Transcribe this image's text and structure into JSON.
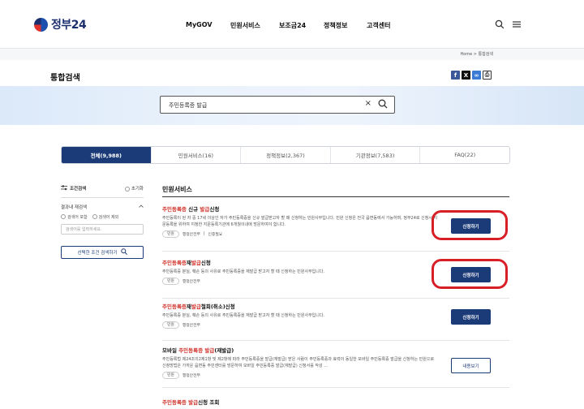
{
  "header": {
    "logo_text": "정부24",
    "nav": [
      "MyGOV",
      "민원서비스",
      "보조금24",
      "정책정보",
      "고객센터"
    ],
    "icons": [
      "search-icon",
      "menu-icon"
    ]
  },
  "breadcrumb": {
    "home": "Home",
    "sep": ">",
    "current": "통합검색"
  },
  "page_title": "통합검색",
  "share_icons": [
    "facebook-icon",
    "x-icon",
    "link-icon",
    "print-icon"
  ],
  "search": {
    "value": "주민등록증 발급",
    "clear_glyph": "×",
    "search_glyph": "⌕"
  },
  "tabs": [
    {
      "label": "전체(9,988)",
      "active": true
    },
    {
      "label": "민원서비스(16)",
      "active": false
    },
    {
      "label": "정책정보(2,367)",
      "active": false
    },
    {
      "label": "기관정보(7,583)",
      "active": false
    },
    {
      "label": "FAQ(22)",
      "active": false
    }
  ],
  "filter": {
    "title": "조건검색",
    "reset": "초기화",
    "sub_title": "결과내 재검색",
    "radio_include": "검색어 포함",
    "radio_exclude": "검색어 제외",
    "keyword_placeholder": "검색어를 입력하세요.",
    "apply_button": "선택한 조건 검색하기"
  },
  "results": {
    "section_title": "민원서비스",
    "items": [
      {
        "title_plain_pre": "",
        "title_hl": "주민등록증",
        "title_mid": " 신규 ",
        "title_hl2": "발급",
        "title_post": "신청",
        "desc": "주민등록이 된 자 중 17세 이상인 자가 주민등록증을 신규 발급받고자 할 때 신청하는 민원사무입니다. 민원 신청은 전국 읍면동에서 가능하며, 정부24로 신청시 지문등록을 위하여 지정한 지문등록기관에 6개월이내에 방문하여야 합니다.",
        "tags": [
          "민원",
          "행정안전부",
          "인증필요"
        ],
        "button": "신청하기"
      },
      {
        "title_plain_pre": "",
        "title_hl": "주민등록증",
        "title_mid": "재",
        "title_hl2": "발급",
        "title_post": "신청",
        "desc": "주민등록증 분실, 훼손 등의 사유로 주민등록증을 재발급 받고자 할 때 신청하는 민원사무입니다.",
        "tags": [
          "민원",
          "행정안전부"
        ],
        "button": "신청하기"
      },
      {
        "title_plain_pre": "",
        "title_hl": "주민등록증",
        "title_mid": "재",
        "title_hl2": "발급",
        "title_post": "철회(취소)신청",
        "desc": "주민등록증 분실, 훼손 등의 사유로 주민등록증을 재발급 받고자 할 때 신청하는 민원사무입니다.",
        "tags": [
          "민원",
          "행정안전부"
        ],
        "button": "신청하기"
      },
      {
        "title_plain_pre": "모바일 ",
        "title_hl": "주민등록증",
        "title_mid": " ",
        "title_hl2": "발급",
        "title_post": "(재발급)",
        "desc": "주민등록법 제24조의2제1항 및 제2항에 따라 주민등록증을 발급(재발급) 받은 사람이 주민등록증과 효력이 동일한 모바일 주민등록증 발급을 신청하는 민원으로 신청방법은 가까운 읍면동 주민센터를 방문하여 모바일 주민등록증 발급(재발급) 신청서를 작성 ...",
        "tags": [
          "민원",
          "행정안전부"
        ],
        "button": "내용보기"
      },
      {
        "title_plain_pre": "",
        "title_hl": "주민등록증 발급",
        "title_mid": "",
        "title_hl2": "",
        "title_post": "신청 조회"
      }
    ]
  },
  "colors": {
    "primary": "#1a3a78",
    "highlight": "#d0342c",
    "annotation": "#d81f27"
  }
}
